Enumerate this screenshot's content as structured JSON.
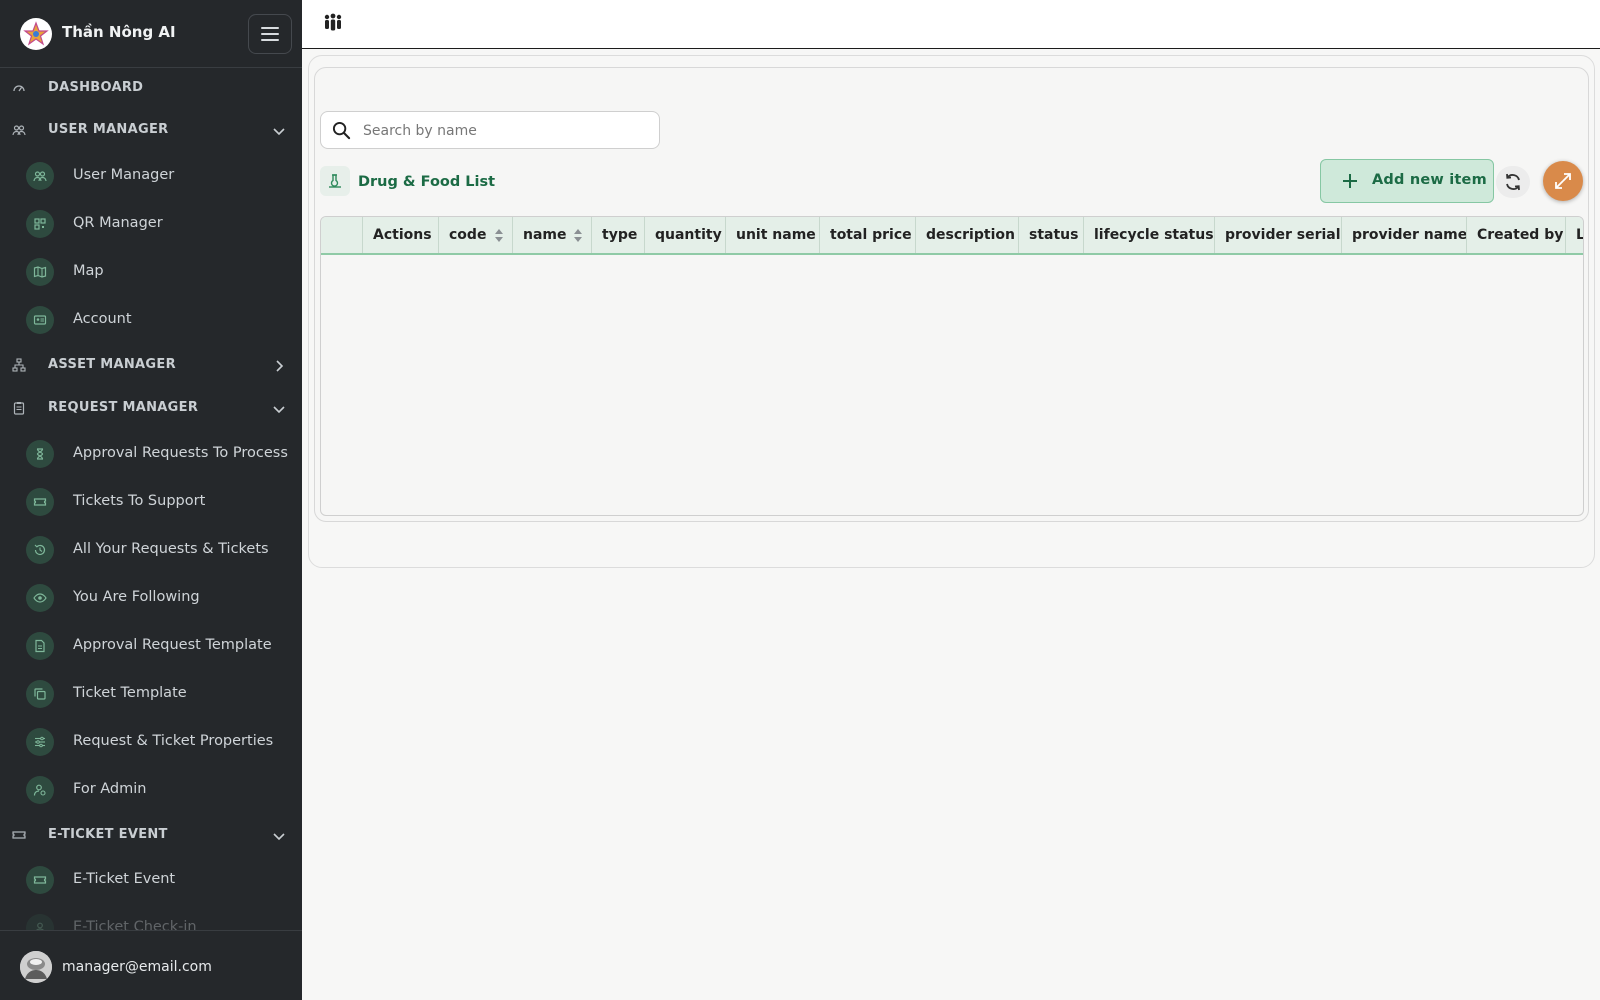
{
  "app": {
    "title": "Thần Nông AI"
  },
  "sidebar": {
    "sections": [
      {
        "label": "DASHBOARD",
        "icon": "gauge-icon",
        "top": 0
      },
      {
        "label": "USER MANAGER",
        "icon": "users-icon",
        "chevron": "down"
      },
      {
        "label": "ASSET MANAGER",
        "icon": "hierarchy-icon",
        "chevron": "right"
      },
      {
        "label": "REQUEST MANAGER",
        "icon": "clipboard-icon",
        "chevron": "down"
      },
      {
        "label": "E-TICKET EVENT",
        "icon": "ticket-icon",
        "chevron": "down"
      }
    ],
    "items": [
      {
        "label": "User Manager",
        "icon": "users-icon"
      },
      {
        "label": "QR Manager",
        "icon": "qr-icon"
      },
      {
        "label": "Map",
        "icon": "map-icon"
      },
      {
        "label": "Account",
        "icon": "id-card-icon"
      },
      {
        "label": "Approval Requests To Process",
        "icon": "hourglass-icon"
      },
      {
        "label": "Tickets To Support",
        "icon": "ticket-icon"
      },
      {
        "label": "All Your Requests & Tickets",
        "icon": "history-icon"
      },
      {
        "label": "You Are Following",
        "icon": "eye-icon"
      },
      {
        "label": "Approval Request Template",
        "icon": "document-icon"
      },
      {
        "label": "Ticket Template",
        "icon": "copy-icon"
      },
      {
        "label": "Request & Ticket Properties",
        "icon": "sliders-icon"
      },
      {
        "label": "For Admin",
        "icon": "admin-icon"
      },
      {
        "label": "E-Ticket Event",
        "icon": "ticket-icon"
      },
      {
        "label": "E-Ticket Check-in",
        "icon": "user-check-icon"
      }
    ],
    "user_email": "manager@email.com"
  },
  "search": {
    "placeholder": "Search by name",
    "value": ""
  },
  "list": {
    "title": "Drug & Food List"
  },
  "toolbar": {
    "add_label": "Add new item"
  },
  "table": {
    "columns": [
      "",
      "Actions",
      "code",
      "name",
      "type",
      "quantity",
      "unit name",
      "total price",
      "description",
      "status",
      "lifecycle status",
      "provider serial",
      "provider name",
      "Created by",
      "L"
    ],
    "sortable": [
      "code",
      "name"
    ],
    "rows": []
  },
  "colors": {
    "sidebar_bg": "#25282b",
    "accent_green": "#1c6b45",
    "header_green": "#e4efe8",
    "add_button_bg": "#cfe9da",
    "expand_button": "#d98a4a"
  }
}
